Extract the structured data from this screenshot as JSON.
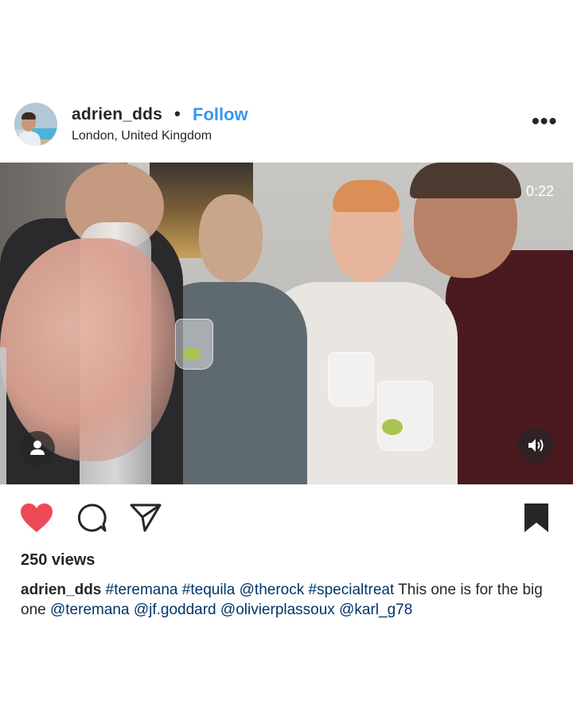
{
  "post": {
    "username": "adrien_dds",
    "separator": "•",
    "follow_label": "Follow",
    "location": "London, United Kingdom",
    "more_label": "•••"
  },
  "video": {
    "timer": "0:22"
  },
  "actions": {
    "like_icon": "heart-filled-icon",
    "comment_icon": "comment-icon",
    "share_icon": "share-icon",
    "save_icon": "bookmark-filled-icon",
    "like_color": "#ed4956"
  },
  "stats": {
    "views": "250 views"
  },
  "caption": {
    "username": "adrien_dds",
    "tokens": [
      {
        "text": "#teremana",
        "type": "hashtag"
      },
      {
        "text": "#tequila",
        "type": "hashtag"
      },
      {
        "text": "@therock",
        "type": "mention"
      },
      {
        "text": "#specialtreat",
        "type": "hashtag"
      },
      {
        "text": "This one is for the big one",
        "type": "text"
      },
      {
        "text": "@teremana",
        "type": "mention"
      },
      {
        "text": "@jf.goddard",
        "type": "mention"
      },
      {
        "text": "@olivierplassoux",
        "type": "mention"
      },
      {
        "text": "@karl_g78",
        "type": "mention"
      }
    ]
  },
  "colors": {
    "link_blue": "#3897f0",
    "tag_navy": "#003569",
    "text": "#262626"
  }
}
